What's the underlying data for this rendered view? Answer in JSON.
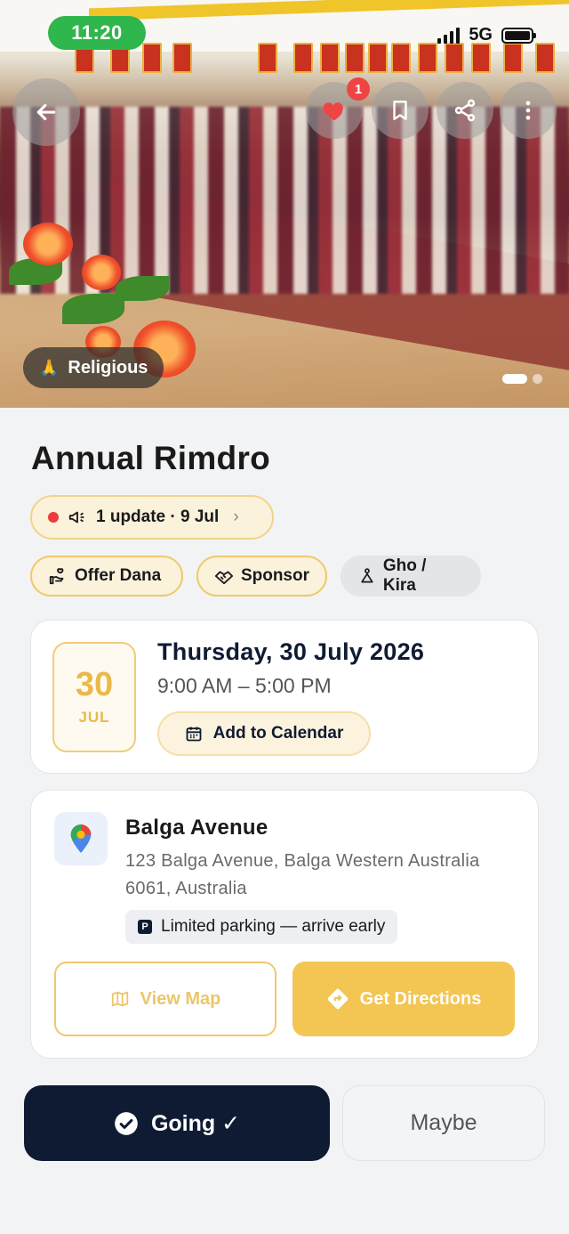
{
  "status_bar": {
    "time": "11:20",
    "network": "5G"
  },
  "hero": {
    "category_label": "Religious",
    "category_icon": "praying-hands-icon",
    "like_count": "1"
  },
  "event": {
    "title": "Annual Rimdro",
    "update_text": "1 update · 9 Jul",
    "chips": {
      "offer_dana": "Offer Dana",
      "sponsor": "Sponsor",
      "dress_code": "Gho / Kira"
    }
  },
  "date_card": {
    "day_num": "30",
    "month": "JUL",
    "date_full": "Thursday, 30 July 2026",
    "time_range": "9:00 AM – 5:00 PM",
    "add_calendar_label": "Add to Calendar"
  },
  "location_card": {
    "name": "Balga Avenue",
    "address": "123 Balga Avenue, Balga Western Australia 6061, Australia",
    "parking_note": "Limited parking — arrive early",
    "view_map_label": "View Map",
    "directions_label": "Get Directions"
  },
  "rsvp": {
    "going_label": "Going ✓",
    "maybe_label": "Maybe"
  },
  "colors": {
    "accent_gold": "#f3c553",
    "navy": "#0f1b33",
    "status_green": "#2fb64c",
    "badge_red": "#ef4444"
  }
}
